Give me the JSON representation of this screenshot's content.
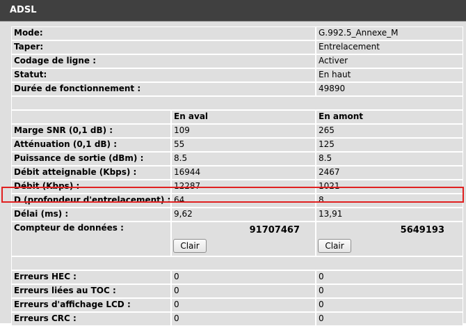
{
  "header": {
    "title": "ADSL"
  },
  "info": [
    {
      "label": "Mode:",
      "value": "G.992.5_Annexe_M"
    },
    {
      "label": "Taper:",
      "value": "Entrelacement"
    },
    {
      "label": "Codage de ligne :",
      "value": "Activer"
    },
    {
      "label": "Statut:",
      "value": "En haut"
    },
    {
      "label": "Durée de fonctionnement :",
      "value": "49890"
    }
  ],
  "columns": {
    "downstream": "En aval",
    "upstream": "En amont"
  },
  "stats": [
    {
      "label": "Marge SNR (0,1 dB) :",
      "down": "109",
      "up": "265"
    },
    {
      "label": "Atténuation (0,1 dB) :",
      "down": "55",
      "up": "125"
    },
    {
      "label": "Puissance de sortie (dBm) :",
      "down": "8.5",
      "up": "8.5"
    },
    {
      "label": "Débit atteignable (Kbps) :",
      "down": "16944",
      "up": "2467"
    },
    {
      "label": "Débit (Kbps) :",
      "down": "12287",
      "up": "1021"
    },
    {
      "label": "D (profondeur d'entrelacement) :",
      "down": "64",
      "up": "8"
    },
    {
      "label": "Délai (ms) :",
      "down": "9,62",
      "up": "13,91"
    }
  ],
  "counter": {
    "label": "Compteur de données :",
    "down": "91707467",
    "up": "5649193",
    "clear_label": "Clair"
  },
  "errors": [
    {
      "label": "Erreurs HEC :",
      "down": "0",
      "up": "0"
    },
    {
      "label": "Erreurs liées au TOC :",
      "down": "0",
      "up": "0"
    },
    {
      "label": "Erreurs d'affichage LCD :",
      "down": "0",
      "up": "0"
    },
    {
      "label": "Erreurs CRC :",
      "down": "0",
      "up": "0"
    }
  ]
}
